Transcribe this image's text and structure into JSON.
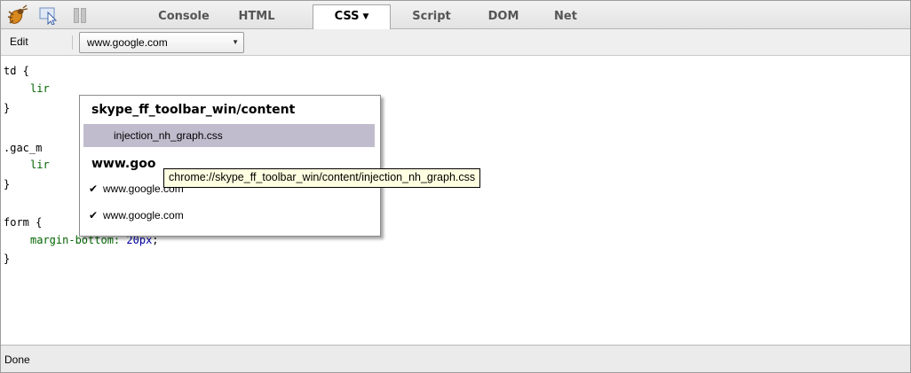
{
  "toolbar": {
    "tabs": [
      {
        "label": "Console"
      },
      {
        "label": "HTML"
      },
      {
        "label": "CSS"
      },
      {
        "label": "Script"
      },
      {
        "label": "DOM"
      },
      {
        "label": "Net"
      }
    ],
    "active_tab": "CSS",
    "icons": [
      "firebug-icon",
      "inspect-icon",
      "pause-icon"
    ]
  },
  "location_bar": {
    "edit_label": "Edit",
    "selected_location": "www.google.com"
  },
  "code": {
    "rule1_open": "td {",
    "rule1_prop_fragment": "lir",
    "rule1_close": "}",
    "rule2_open_fragment": ".gac_m",
    "rule2_prop_fragment": "lir",
    "rule2_close": "}",
    "rule3_open": "form {",
    "rule3_prop": "margin-bottom:",
    "rule3_value": "20px",
    "rule3_semicolon": ";",
    "rule3_close": "}"
  },
  "menu": {
    "group1_header": "skype_ff_toolbar_win/content",
    "group1_items": [
      {
        "label": "injection_nh_graph.css",
        "checked": false,
        "highlighted": true
      }
    ],
    "group2_header_visible": "www.goo",
    "group2_items": [
      {
        "label": "www.google.com",
        "checked": true
      },
      {
        "label": "www.google.com",
        "checked": true
      }
    ]
  },
  "tooltip": {
    "text": "chrome://skype_ff_toolbar_win/content/injection_nh_graph.css"
  },
  "status": {
    "text": "Done"
  },
  "colors": {
    "property": "#006400",
    "value": "#0000a0",
    "menu_highlight": "#c1bccd",
    "tooltip_bg": "#ffffe1"
  }
}
